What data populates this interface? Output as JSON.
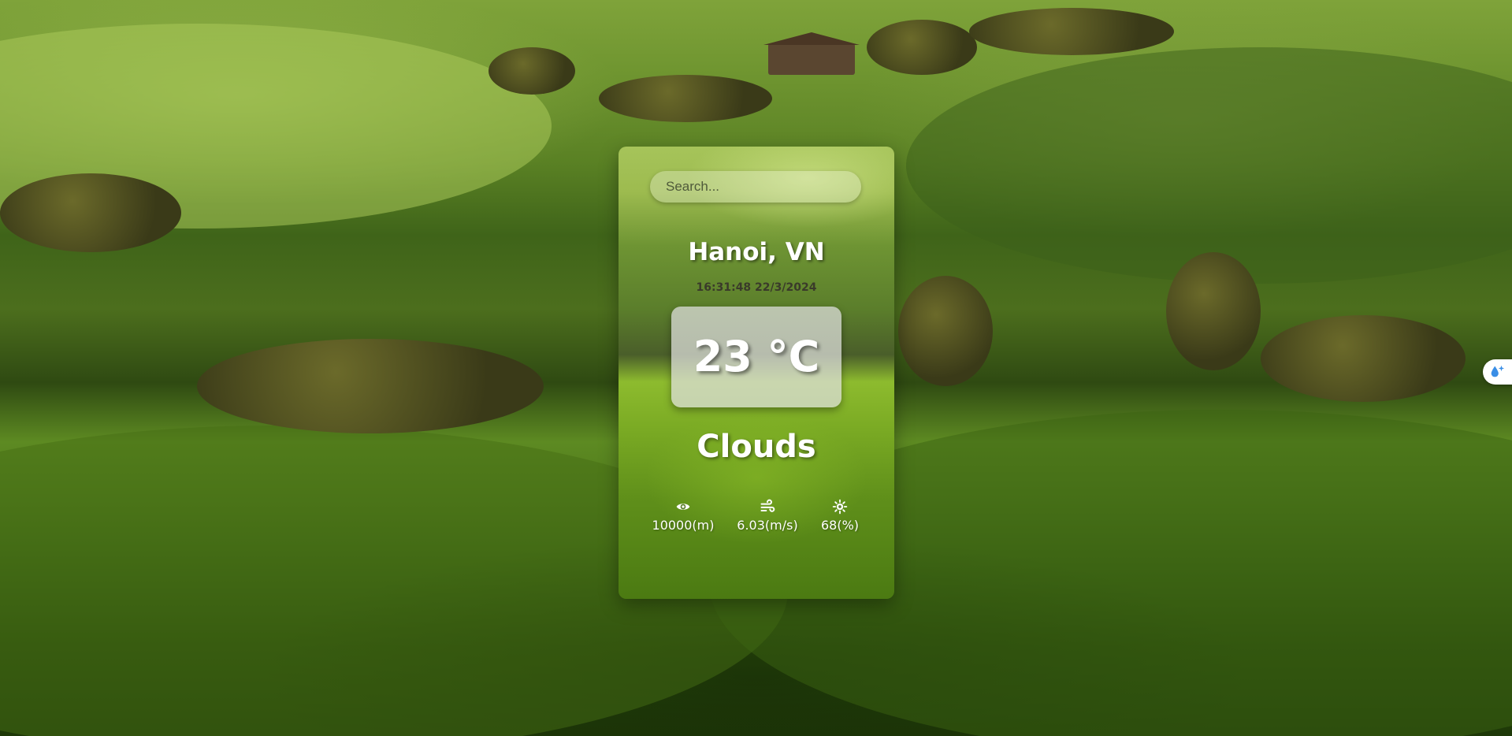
{
  "search": {
    "placeholder": "Search...",
    "value": ""
  },
  "location": {
    "city": "Hanoi, VN"
  },
  "datetime": "16:31:48 22/3/2024",
  "temperature": "23 °C",
  "condition": "Clouds",
  "stats": [
    {
      "icon": "eye-icon",
      "value": "10000(m)"
    },
    {
      "icon": "wind-icon",
      "value": "6.03(m/s)"
    },
    {
      "icon": "humidity-icon",
      "value": "68(%)"
    }
  ],
  "side_widget": {
    "icon": "droplet-sparkle-icon"
  },
  "colors": {
    "card_text": "#ffffff",
    "time_text": "#3a3a2a",
    "temp_box": "#e1e1e1",
    "widget_accent": "#3a8ee6"
  }
}
